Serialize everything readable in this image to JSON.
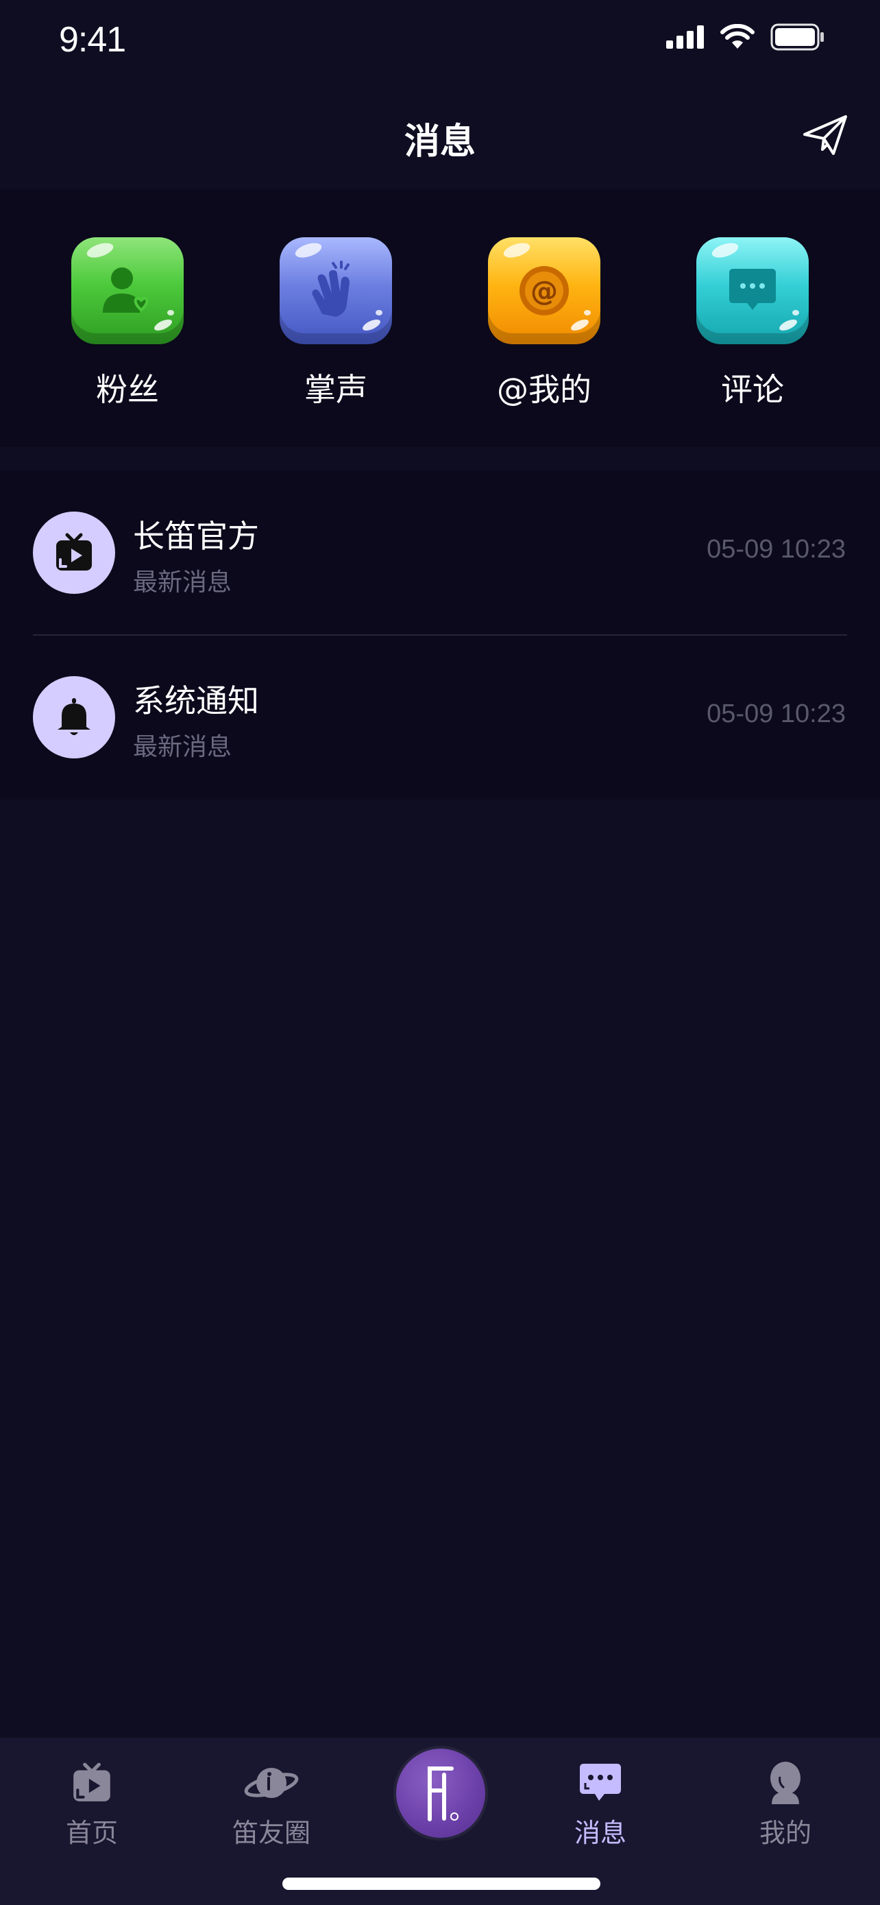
{
  "status_bar": {
    "time": "9:41"
  },
  "header": {
    "title": "消息",
    "send_icon": "paper-plane-icon"
  },
  "categories": [
    {
      "label": "粉丝",
      "icon": "fans-icon",
      "color": "#4cc93b"
    },
    {
      "label": "掌声",
      "icon": "clap-icon",
      "color": "#6c7fe0"
    },
    {
      "label": "@我的",
      "icon": "at-icon",
      "color": "#ffb412"
    },
    {
      "label": "评论",
      "icon": "comment-icon",
      "color": "#34cfd6"
    }
  ],
  "messages": [
    {
      "title": "长笛官方",
      "subtitle": "最新消息",
      "time": "05-09 10:23",
      "icon": "tv-icon"
    },
    {
      "title": "系统通知",
      "subtitle": "最新消息",
      "time": "05-09 10:23",
      "icon": "bell-icon"
    }
  ],
  "tab_bar": {
    "items": [
      {
        "label": "首页",
        "icon": "tv-icon",
        "active": false
      },
      {
        "label": "笛友圈",
        "icon": "planet-icon",
        "active": false
      },
      {
        "label": "",
        "icon": "flute-logo-icon",
        "active": false
      },
      {
        "label": "消息",
        "icon": "chat-bubble-icon",
        "active": true
      },
      {
        "label": "我的",
        "icon": "profile-icon",
        "active": false
      }
    ]
  },
  "colors": {
    "background": "#0f0d21",
    "accent": "#c5bcff",
    "avatar_bg": "#d5cdff"
  }
}
